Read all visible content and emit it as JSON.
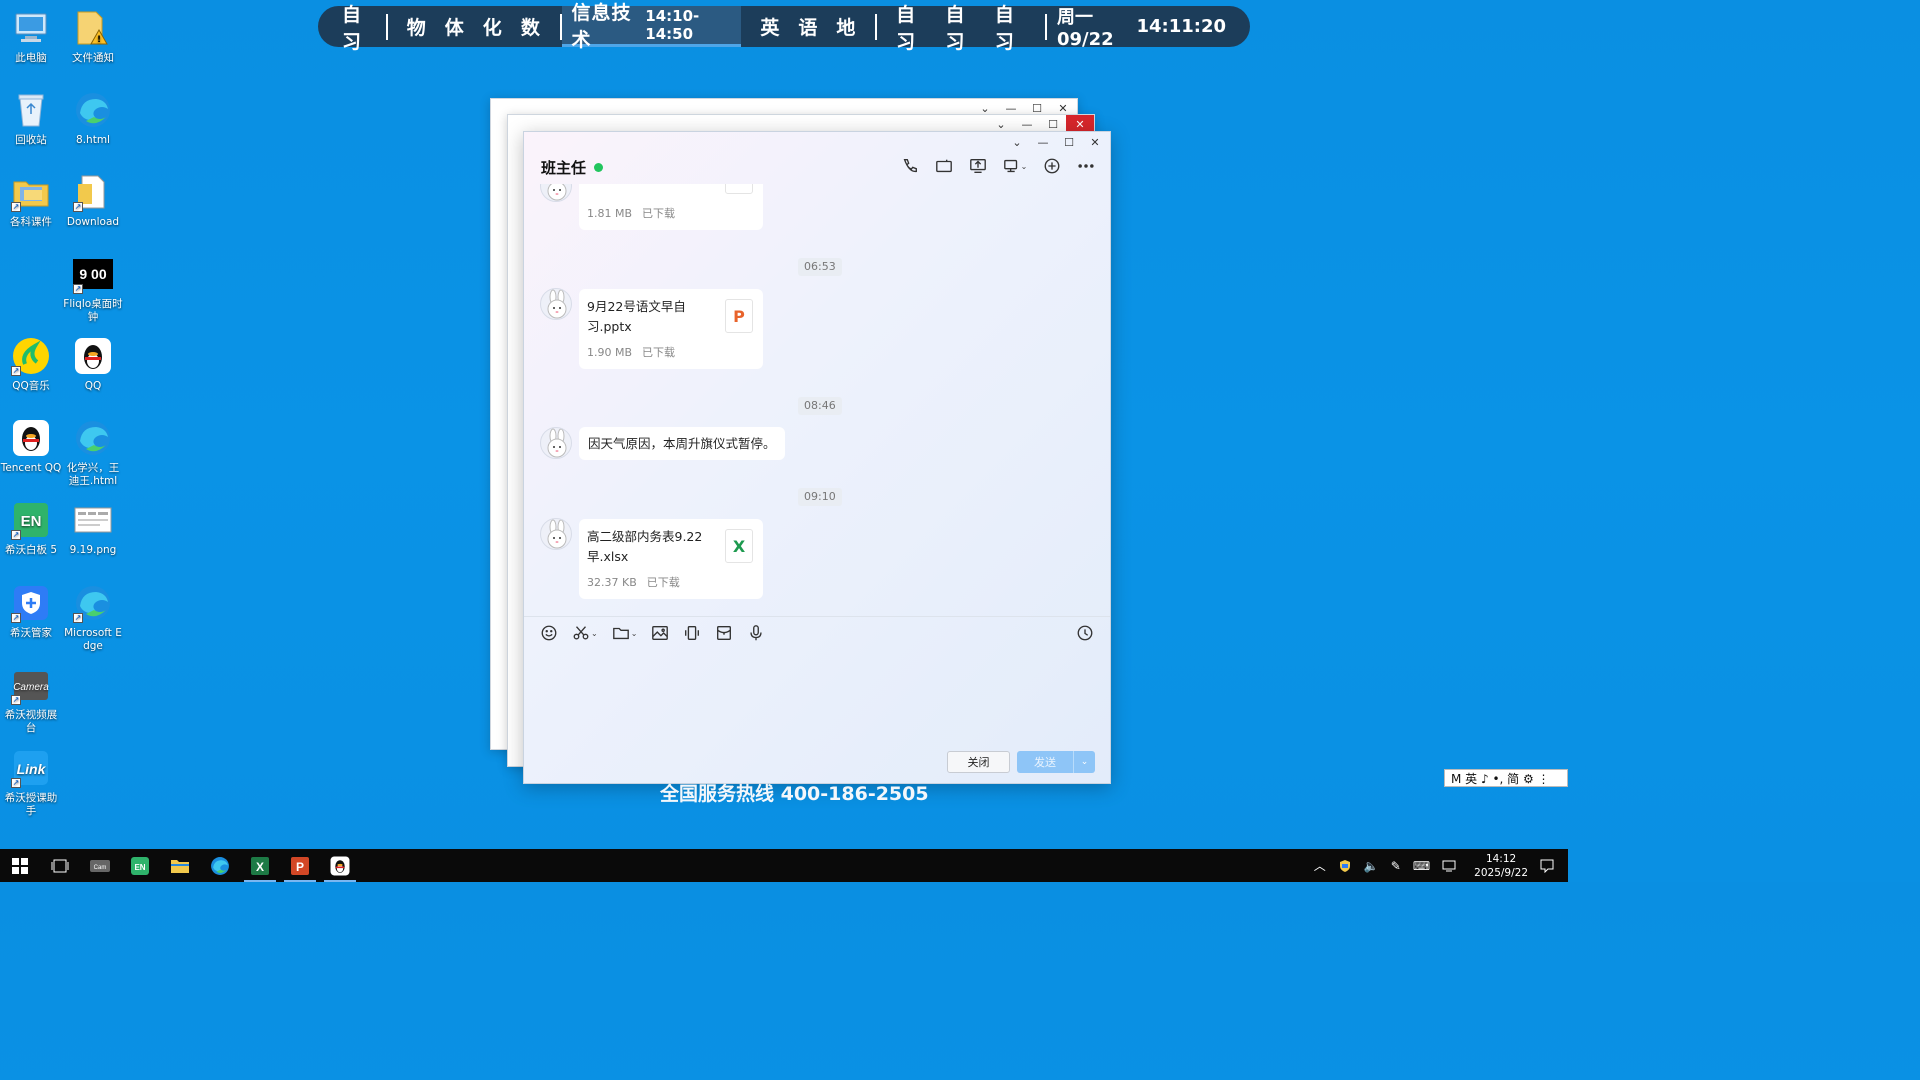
{
  "desktop": {
    "icons": [
      {
        "label": "此电脑"
      },
      {
        "label": "文件通知"
      },
      {
        "label": "回收站"
      },
      {
        "label": "8.html"
      },
      {
        "label": "各科课件"
      },
      {
        "label": "Download"
      },
      {
        "label": "Fliqlo桌面时钟"
      },
      {
        "label": "QQ音乐"
      },
      {
        "label": "QQ"
      },
      {
        "label": "Tencent QQ"
      },
      {
        "label": "化学兴，王迪王.html"
      },
      {
        "label": "希沃白板 5"
      },
      {
        "label": "9.19.png"
      },
      {
        "label": "希沃管家"
      },
      {
        "label": "Microsoft Edge"
      },
      {
        "label": "希沃视频展台"
      },
      {
        "label": "希沃授课助手"
      }
    ],
    "fliqlo_time": "9 00",
    "hotline": "全国服务热线 400-186-2505"
  },
  "schedule": {
    "seg1": "自习",
    "seg2": [
      "物",
      "体",
      "化",
      "数"
    ],
    "active_subject": "信息技术",
    "active_time": "14:10-14:50",
    "seg4": [
      "英",
      "语",
      "地"
    ],
    "seg5": [
      "自习",
      "自习",
      "自习"
    ],
    "date": "周一 09/22",
    "clock": "14:11:20"
  },
  "chat": {
    "title": "班主任",
    "online_color": "#22c55e",
    "window_controls": {
      "dropdown": "⌄",
      "minimize": "—",
      "maximize": "☐",
      "close": "✕"
    },
    "top_partial_file": {
      "size": "1.81 MB",
      "status": "已下载"
    },
    "messages": [
      {
        "time": "06:53",
        "type": "file",
        "name": "9月22号语文早自习.pptx",
        "size": "1.90 MB",
        "status": "已下载",
        "file_icon": "P",
        "icon_color": "#e8632b"
      },
      {
        "time": "08:46",
        "type": "text",
        "text": "因天气原因，本周升旗仪式暂停。"
      },
      {
        "time": "09:10",
        "type": "file",
        "name": "高二级部内务表9.22早.xlsx",
        "size": "32.37 KB",
        "status": "已下载",
        "file_icon": "X",
        "icon_color": "#1d9a4f"
      }
    ],
    "close_label": "关闭",
    "send_label": "发送"
  },
  "ime": "M 英 ♪ •, 简 ⚙ ⋮",
  "taskbar": {
    "time": "14:12",
    "date": "2025/9/22"
  }
}
